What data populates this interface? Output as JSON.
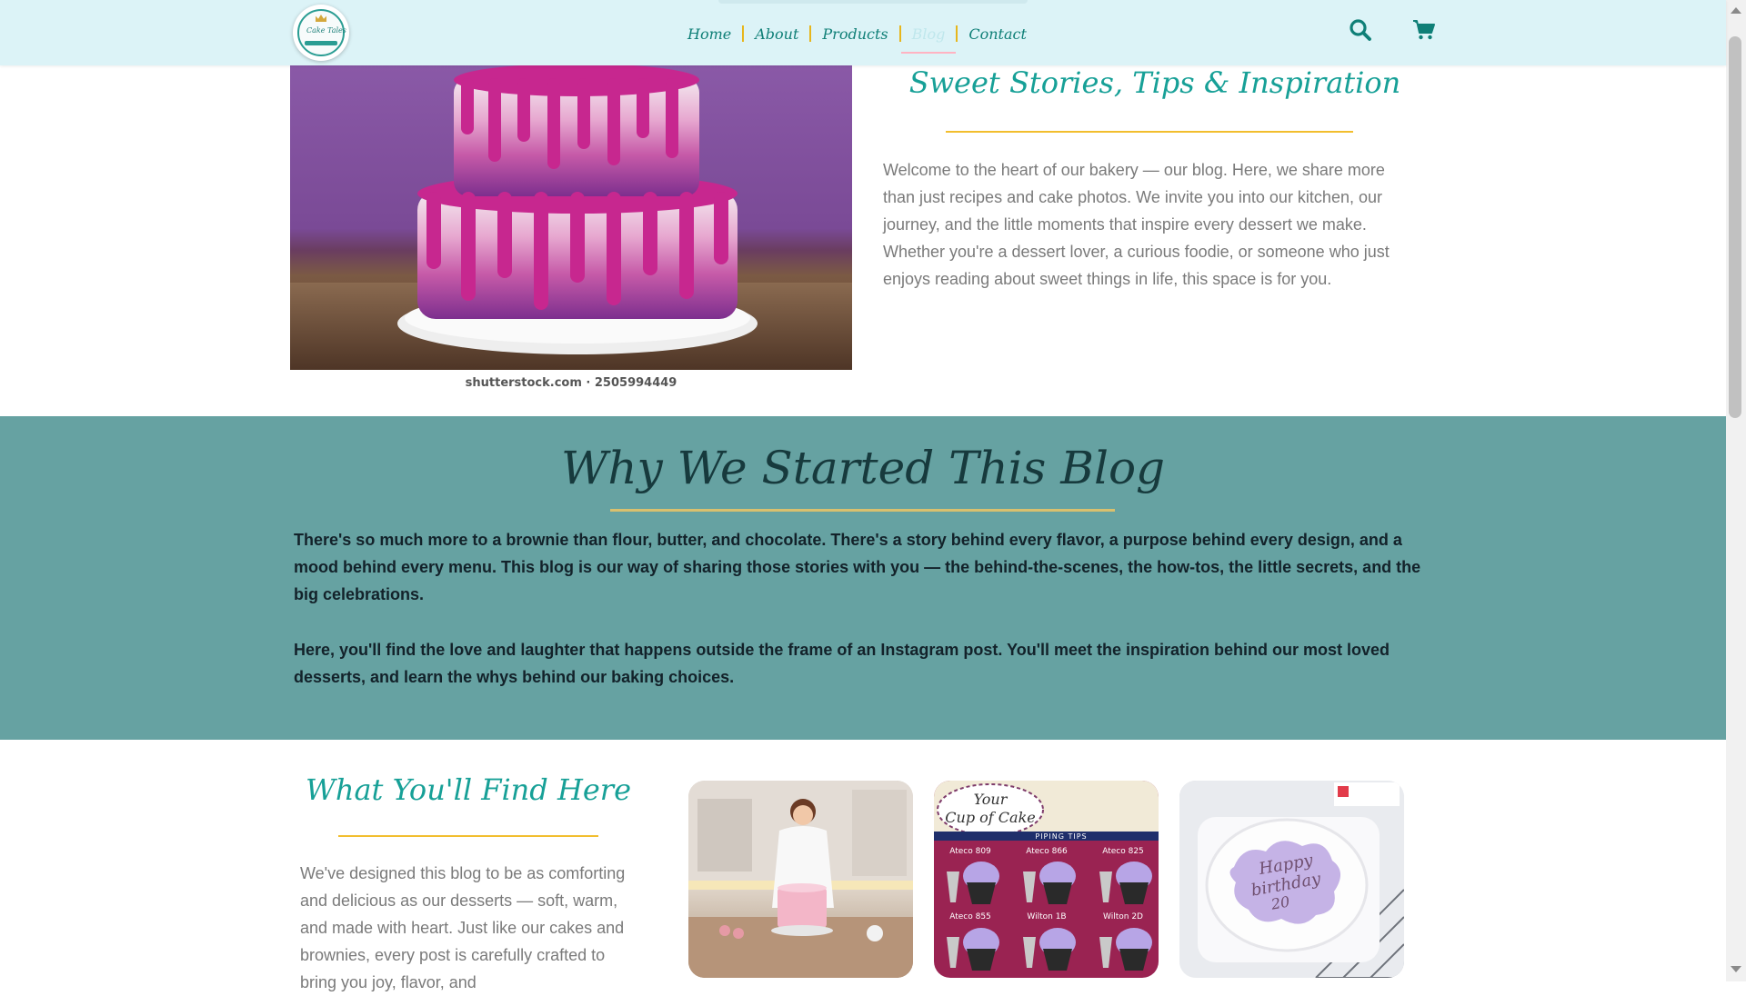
{
  "header": {
    "logo_text": "Cake Tales",
    "nav": [
      {
        "label": "Home"
      },
      {
        "label": "About"
      },
      {
        "label": "Products"
      },
      {
        "label": "Blog"
      },
      {
        "label": "Contact"
      }
    ],
    "active_nav": "Blog",
    "icons": [
      "search-icon",
      "cart-icon"
    ]
  },
  "hero": {
    "image_caption": "shutterstock.com · 2505994449",
    "title": "Sweet Stories, Tips & Inspiration",
    "text": "Welcome to the heart of our bakery — our blog. Here, we share more than just recipes and cake photos. We invite you into our kitchen, our journey, and the little moments that inspire every dessert we make. Whether you're a dessert lover, a curious foodie, or someone who just enjoys reading about sweet things in life, this space is for you."
  },
  "why": {
    "title": "Why We Started This Blog",
    "paragraph1": "There's so much more to a brownie than flour, butter, and chocolate. There's a story behind every flavor, a purpose behind every design, and a mood behind every menu. This blog is our way of sharing those stories with you — the behind-the-scenes, the how-tos, the little secrets, and the big celebrations.",
    "paragraph2": "Here, you'll find the love and laughter that happens outside the frame of an Instagram post. You'll meet the inspiration behind our most loved desserts, and learn the whys behind our baking choices."
  },
  "find": {
    "title": "What You'll Find Here",
    "text": "We've designed this blog to be as comforting and delicious as our desserts — soft, warm, and made with heart. Just like our cakes and brownies, every post is carefully crafted to bring you joy, flavor, and"
  },
  "thumbs": {
    "piping": {
      "brand_line1": "Your",
      "brand_line2": "Cup of Cake",
      "banner": "PIPING TIPS",
      "tips": [
        "Ateco 809",
        "Ateco 866",
        "Ateco 825",
        "Ateco 855",
        "Wilton 1B",
        "Wilton 2D"
      ]
    },
    "birthday": {
      "line1": "Happy",
      "line2": "birthday",
      "line3": "20"
    }
  },
  "colors": {
    "header_bg": "#dcf3f7",
    "accent_teal": "#17a097",
    "accent_yellow": "#f2be2e",
    "section_teal": "#66a2a2"
  }
}
